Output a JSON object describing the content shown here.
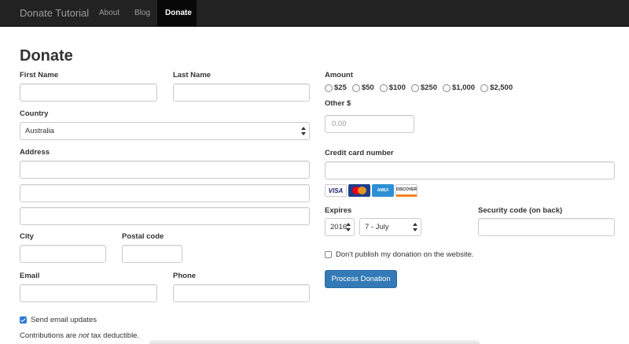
{
  "navbar": {
    "brand": "Donate Tutorial",
    "links": [
      "About",
      "Blog",
      "Donate"
    ]
  },
  "page_title": "Donate",
  "form": {
    "first_name_label": "First Name",
    "last_name_label": "Last Name",
    "country_label": "Country",
    "country_value": "Australia",
    "address_label": "Address",
    "city_label": "City",
    "postal_code_label": "Postal code",
    "email_label": "Email",
    "phone_label": "Phone",
    "send_updates_label": "Send email updates",
    "send_updates_checked": true,
    "note_before": "Contributions are ",
    "note_em": "not",
    "note_after": " tax deductible."
  },
  "payment": {
    "amount_label": "Amount",
    "amounts": [
      "$25",
      "$50",
      "$100",
      "$250",
      "$1,000",
      "$2,500"
    ],
    "other_label": "Other $",
    "other_placeholder": "0.00",
    "card_number_label": "Credit card number",
    "card_brands": [
      "VISA",
      "MasterCard",
      "AMERICAN EXPRESS",
      "DISCOVER"
    ],
    "expires_label": "Expires",
    "expires_year": "2016",
    "expires_month": "7 - July",
    "security_code_label": "Security code (on back)",
    "dont_publish_label": "Don't publish my donation on the website.",
    "dont_publish_checked": false,
    "submit_label": "Process Donation"
  },
  "colors": {
    "navbar_bg": "#222222",
    "primary_button": "#337ab7"
  }
}
